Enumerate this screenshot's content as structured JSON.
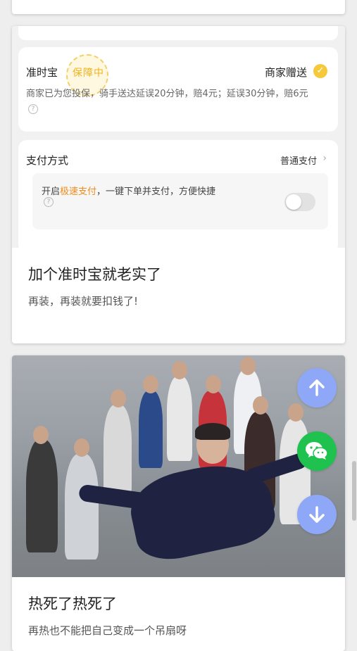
{
  "feed": {
    "card1": {
      "title": "加个准时宝就老实了",
      "desc": "再装，再装就要扣钱了!",
      "screenshot": {
        "insurance_title": "准时宝",
        "insurance_stamp": "保障中",
        "insurance_right": "商家赠送",
        "insurance_desc": "商家已为您投保，骑手送达延误20分钟，赔4元；延误30分钟，赔6元",
        "payment_title": "支付方式",
        "payment_value": "普通支付",
        "payment_option_prefix": "开启",
        "payment_option_highlight": "极速支付",
        "payment_option_suffix": "，一键下单并支付，方便快捷",
        "toggle_on": false
      }
    },
    "card2": {
      "title": "热死了热死了",
      "desc": "再热也不能把自己变成一个吊扇呀"
    }
  },
  "fabs": {
    "up_icon": "arrow-up-icon",
    "wechat_icon": "wechat-icon",
    "down_icon": "arrow-down-icon"
  },
  "colors": {
    "fab_blue": "#8ea8f7",
    "fab_green": "#1fc14f",
    "highlight_orange": "#f08c1a",
    "check_yellow": "#f6c93a"
  }
}
